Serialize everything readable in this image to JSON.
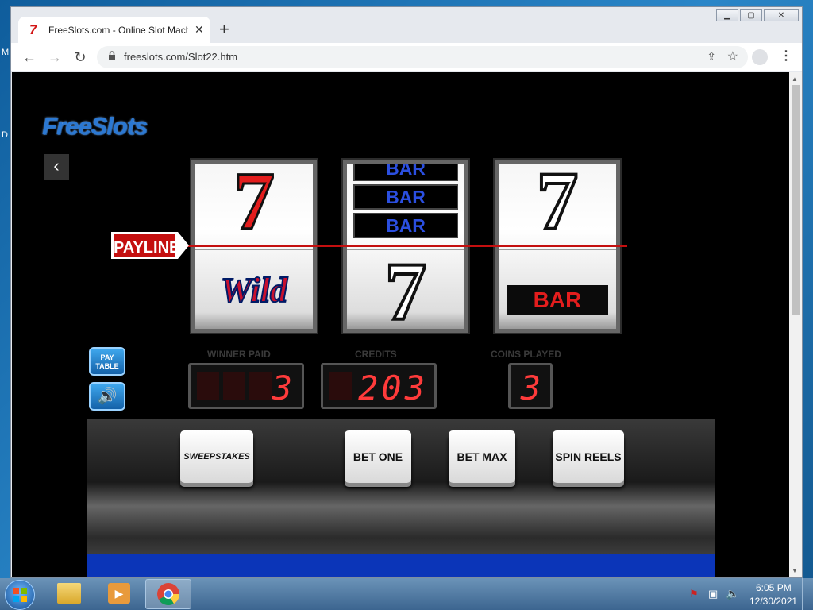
{
  "browser": {
    "tab_title": "FreeSlots.com - Online Slot Mach",
    "url": "freeslots.com/Slot22.htm",
    "new_tab_label": "+",
    "close_label": "✕"
  },
  "game": {
    "logo": "FreeSlots",
    "payline_label": "PAYLINE",
    "reels": [
      {
        "top": "7",
        "bottom": "Wild"
      },
      {
        "top": [
          "BAR",
          "BAR",
          "BAR"
        ],
        "bottom": "7"
      },
      {
        "top": "7",
        "bottom": "BAR"
      }
    ],
    "meters": {
      "winner_paid_label": "WINNER PAID",
      "winner_paid": "3",
      "credits_label": "CREDITS",
      "credits": "203",
      "coins_played_label": "COINS PLAYED",
      "coins_played": "3"
    },
    "paytable_label": "PAY TABLE",
    "buttons": {
      "sweepstakes": "SWEEPSTAKES",
      "bet_one": "BET ONE",
      "bet_max": "BET MAX",
      "spin_reels": "SPIN REELS"
    }
  },
  "taskbar": {
    "time": "6:05 PM",
    "date": "12/30/2021"
  },
  "colors": {
    "seven_red": "#e31d1d",
    "bar_blue": "#2b4fe0",
    "payline_red": "#c40f0f",
    "meter_digit": "#ff3b3b"
  }
}
